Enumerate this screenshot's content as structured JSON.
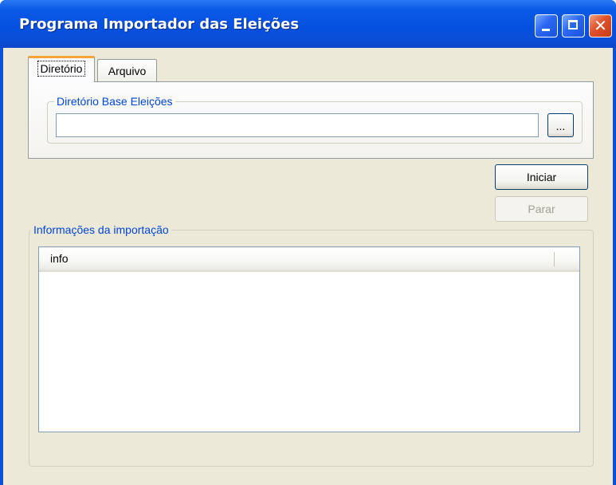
{
  "window": {
    "title": "Programa Importador das Eleições"
  },
  "tabs": [
    {
      "label": "Diretório",
      "active": true
    },
    {
      "label": "Arquivo",
      "active": false
    }
  ],
  "directory_group": {
    "legend": "Diretório Base Eleições",
    "input_value": "",
    "browse_label": "..."
  },
  "buttons": {
    "start_label": "Iniciar",
    "stop_label": "Parar",
    "stop_enabled": false
  },
  "info_group": {
    "legend": "Informações da importação",
    "columns": [
      "info"
    ],
    "rows": []
  },
  "colors": {
    "titlebar": "#0550e0",
    "group_legend": "#0046d5",
    "client_bg": "#ece9d8",
    "active_tab_accent": "#f7a53a"
  },
  "icons": {
    "minimize": "minimize-icon",
    "maximize": "maximize-icon",
    "close": "close-icon"
  }
}
